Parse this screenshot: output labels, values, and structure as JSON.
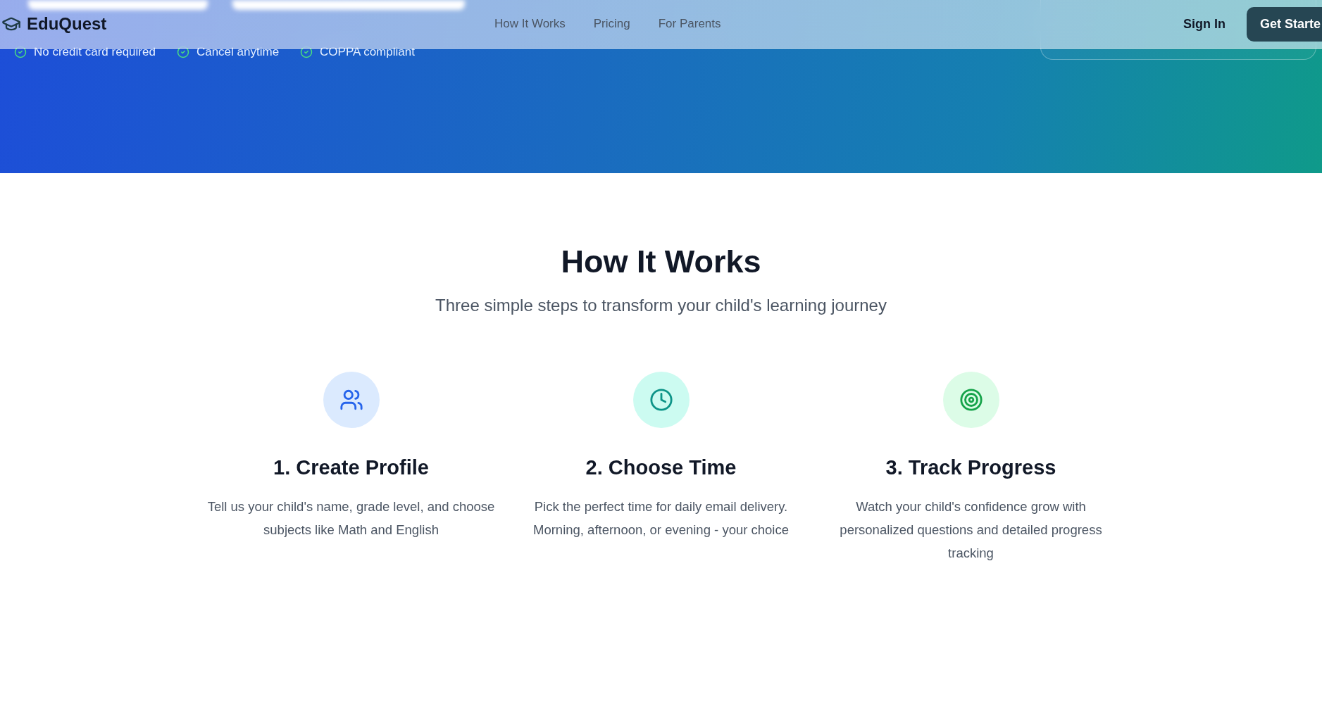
{
  "header": {
    "logo": "EduQuest",
    "nav": [
      "How It Works",
      "Pricing",
      "For Parents"
    ],
    "sign_in": "Sign In",
    "cta": "Get Starte"
  },
  "hero": {
    "badges": [
      "No credit card required",
      "Cancel anytime",
      "COPPA compliant"
    ]
  },
  "how_it_works": {
    "title": "How It Works",
    "subtitle": "Three simple steps to transform your child's learning journey",
    "steps": [
      {
        "kind": "profile",
        "title": "1. Create Profile",
        "text": "Tell us your child's name, grade level, and choose subjects like Math and English"
      },
      {
        "kind": "time",
        "title": "2. Choose Time",
        "text": "Pick the perfect time for daily email delivery. Morning, afternoon, or evening - your choice"
      },
      {
        "kind": "progress",
        "title": "3. Track Progress",
        "text": "Watch your child's confidence grow with personalized questions and detailed progress tracking"
      }
    ]
  }
}
